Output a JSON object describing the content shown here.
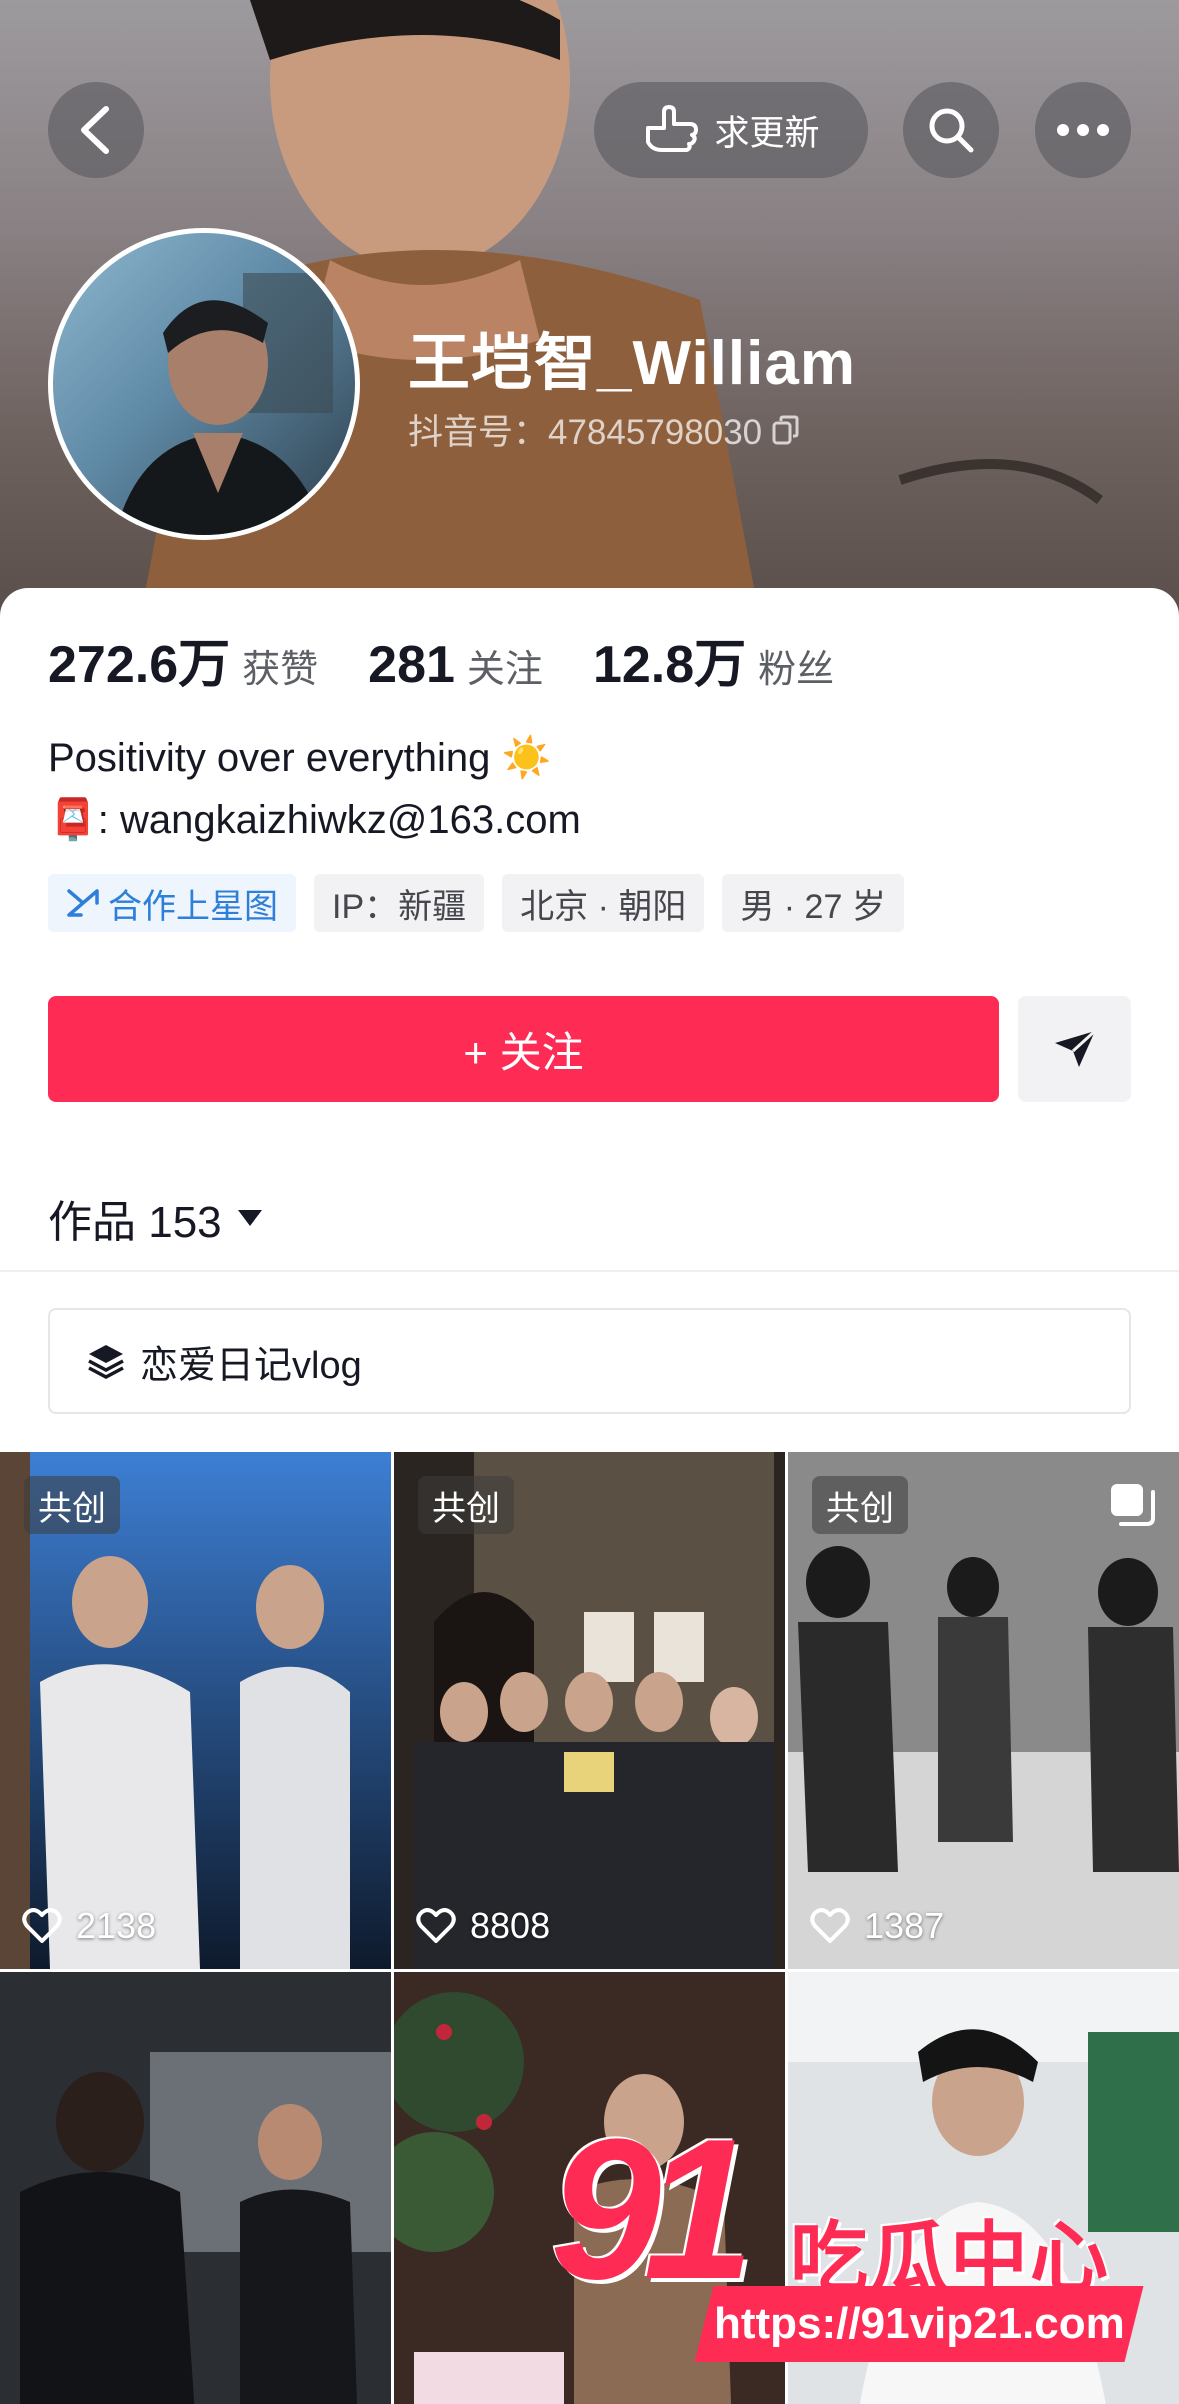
{
  "header": {
    "update_request_label": "求更新",
    "back_icon": "chevron-left-icon",
    "search_icon": "search-icon",
    "more_icon": "more-dots-icon"
  },
  "profile": {
    "name": "王垲智_William",
    "account_id": "抖音号：47845798030",
    "stats": [
      {
        "value": "272.6万",
        "label": "获赞"
      },
      {
        "value": "281",
        "label": "关注"
      },
      {
        "value": "12.8万",
        "label": "粉丝"
      }
    ],
    "bio_line1": "Positivity over everything ☀️",
    "bio_line2": "📮: wangkaizhiwkz@163.com",
    "tags": [
      "合作上星图",
      "IP：新疆",
      "北京 · 朝阳",
      "男 · 27 岁"
    ]
  },
  "actions": {
    "follow_label": "+ 关注"
  },
  "works": {
    "label": "作品 153",
    "collection_label": "恋爱日记vlog"
  },
  "grid": [
    {
      "badge": "共创",
      "likes": "2138"
    },
    {
      "badge": "共创",
      "likes": "8808"
    },
    {
      "badge": "共创",
      "likes": "1387"
    },
    {
      "badge": "",
      "likes": ""
    },
    {
      "badge": "",
      "likes": ""
    },
    {
      "badge": "",
      "likes": ""
    }
  ],
  "watermark": {
    "number": "91",
    "text": "吃瓜中心",
    "url": "https://91vip21.com"
  },
  "colors": {
    "accent": "#fe2c55",
    "tag_blue": "#2d7fd9"
  }
}
